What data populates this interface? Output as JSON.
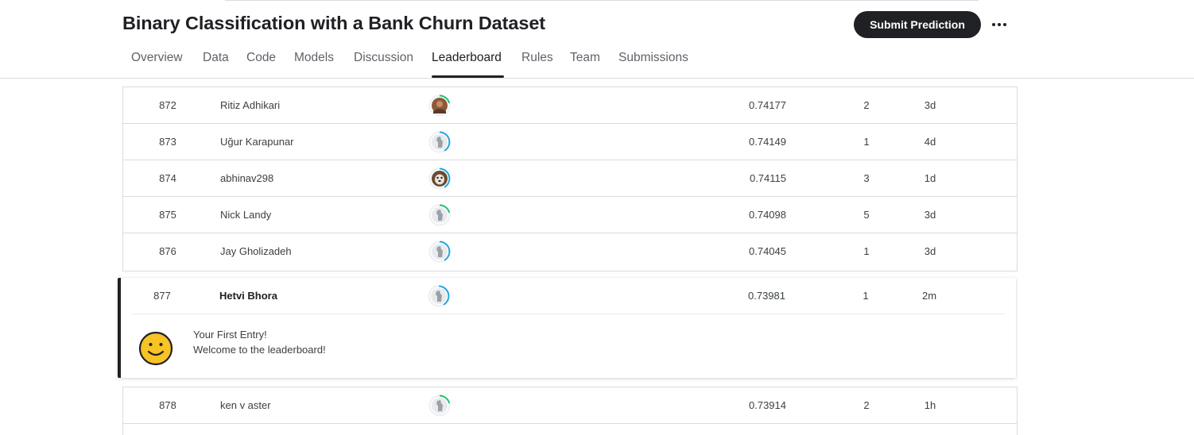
{
  "header": {
    "title": "Binary Classification with a Bank Churn Dataset",
    "submit_label": "Submit Prediction",
    "more_icon": "more-horizontal-icon"
  },
  "tabs": [
    {
      "label": "Overview"
    },
    {
      "label": "Data"
    },
    {
      "label": "Code"
    },
    {
      "label": "Models"
    },
    {
      "label": "Discussion"
    },
    {
      "label": "Leaderboard",
      "active": true
    },
    {
      "label": "Rules"
    },
    {
      "label": "Team"
    },
    {
      "label": "Submissions"
    }
  ],
  "leaderboard": {
    "rows_before": [
      {
        "rank": "872",
        "name": "Ritiz Adhikari",
        "score": "0.74177",
        "entries": "2",
        "last": "3d",
        "avatar": "photo-avatar",
        "ring": "green"
      },
      {
        "rank": "873",
        "name": "Uğur Karapunar",
        "score": "0.74149",
        "entries": "1",
        "last": "4d",
        "avatar": "default-avatar",
        "ring": "blue"
      },
      {
        "rank": "874",
        "name": "abhinav298",
        "score": "0.74115",
        "entries": "3",
        "last": "1d",
        "avatar": "dog-avatar",
        "ring": "blue"
      },
      {
        "rank": "875",
        "name": "Nick Landy",
        "score": "0.74098",
        "entries": "5",
        "last": "3d",
        "avatar": "default-avatar",
        "ring": "green"
      },
      {
        "rank": "876",
        "name": "Jay Gholizadeh",
        "score": "0.74045",
        "entries": "1",
        "last": "3d",
        "avatar": "default-avatar",
        "ring": "blue"
      }
    ],
    "current": {
      "rank": "877",
      "name": "Hetvi Bhora",
      "score": "0.73981",
      "entries": "1",
      "last": "2m",
      "avatar": "default-avatar",
      "ring": "blue",
      "message_line1": "Your First Entry!",
      "message_line2": "Welcome to the leaderboard!"
    },
    "rows_after": [
      {
        "rank": "878",
        "name": "ken v aster",
        "score": "0.73914",
        "entries": "2",
        "last": "1h",
        "avatar": "default-avatar",
        "ring": "green"
      }
    ]
  },
  "colors": {
    "ring_green": "#20beb0",
    "ring_green_alt": "#1fc16b",
    "ring_blue": "#20a5e0",
    "accent": "#202124",
    "smiley": "#f7c325"
  }
}
